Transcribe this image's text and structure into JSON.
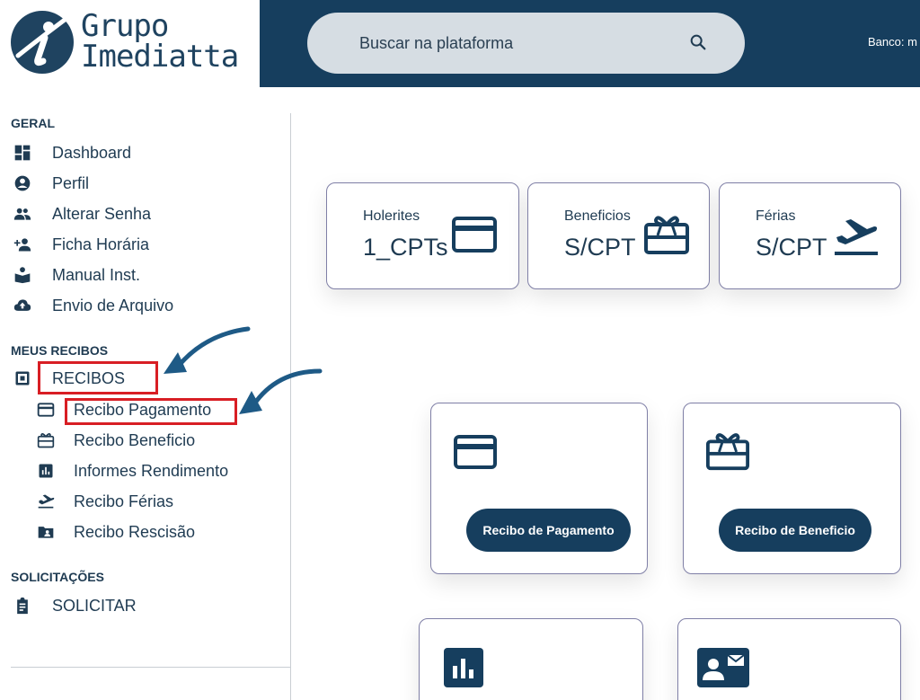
{
  "brand": {
    "line1": "Grupo",
    "line2": "Imediatta"
  },
  "search": {
    "placeholder": "Buscar na plataforma"
  },
  "header": {
    "bank_label": "Banco: m"
  },
  "sidebar": {
    "sections": [
      {
        "title": "GERAL",
        "items": [
          {
            "label": "Dashboard",
            "icon": "dashboard-icon"
          },
          {
            "label": "Perfil",
            "icon": "account-circle-icon"
          },
          {
            "label": "Alterar Senha",
            "icon": "people-icon"
          },
          {
            "label": "Ficha Horária",
            "icon": "person-add-icon"
          },
          {
            "label": "Manual Inst.",
            "icon": "reading-person-icon"
          },
          {
            "label": "Envio de Arquivo",
            "icon": "cloud-upload-icon"
          }
        ]
      },
      {
        "title": "MEUS RECIBOS",
        "items": [
          {
            "label": "RECIBOS",
            "icon": "receipt-box-icon"
          }
        ],
        "subitems": [
          {
            "label": "Recibo Pagamento",
            "icon": "credit-card-icon"
          },
          {
            "label": "Recibo Beneficio",
            "icon": "gift-card-icon"
          },
          {
            "label": "Informes Rendimento",
            "icon": "bar-chart-icon"
          },
          {
            "label": "Recibo Férias",
            "icon": "flight-takeoff-icon"
          },
          {
            "label": "Recibo Rescisão",
            "icon": "folder-person-icon"
          }
        ]
      },
      {
        "title": "SOLICITAÇÕES",
        "items": [
          {
            "label": "SOLICITAR",
            "icon": "clipboard-icon"
          }
        ]
      }
    ]
  },
  "stats": [
    {
      "label": "Holerites",
      "value": "1_CPTs",
      "icon": "credit-card-icon"
    },
    {
      "label": "Beneficios",
      "value": "S/CPT",
      "icon": "gift-card-icon"
    },
    {
      "label": "Férias",
      "value": "S/CPT",
      "icon": "flight-takeoff-icon"
    }
  ],
  "actions": [
    {
      "button": "Recibo de Pagamento",
      "icon": "credit-card-icon"
    },
    {
      "button": "Recibo de Beneficio",
      "icon": "gift-card-icon"
    },
    {
      "icon": "bar-chart-icon"
    },
    {
      "icon": "contact-mail-icon"
    }
  ],
  "colors": {
    "primary": "#163e5e",
    "text": "#1f3b52",
    "highlight": "#d81e24",
    "annotation_arrow": "#1e5a86"
  }
}
